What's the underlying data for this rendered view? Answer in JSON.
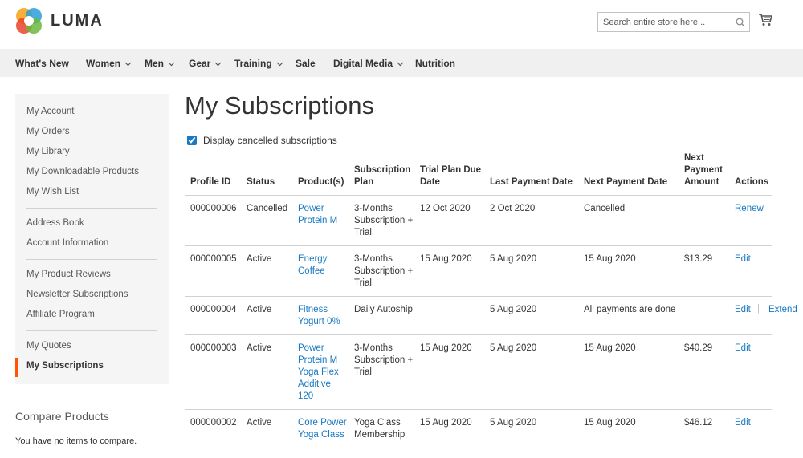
{
  "logo": {
    "text": "LUMA"
  },
  "search": {
    "placeholder": "Search entire store here..."
  },
  "nav": [
    {
      "label": "What's New",
      "dropdown": false
    },
    {
      "label": "Women",
      "dropdown": true
    },
    {
      "label": "Men",
      "dropdown": true
    },
    {
      "label": "Gear",
      "dropdown": true
    },
    {
      "label": "Training",
      "dropdown": true
    },
    {
      "label": "Sale",
      "dropdown": false
    },
    {
      "label": "Digital Media",
      "dropdown": true
    },
    {
      "label": "Nutrition",
      "dropdown": false
    }
  ],
  "sidebar": {
    "items": [
      "My Account",
      "My Orders",
      "My Library",
      "My Downloadable Products",
      "My Wish List",
      "Address Book",
      "Account Information",
      "My Product Reviews",
      "Newsletter Subscriptions",
      "Affiliate Program",
      "My Quotes",
      "My Subscriptions"
    ],
    "current": "My Subscriptions"
  },
  "compare": {
    "title": "Compare Products",
    "text": "You have no items to compare."
  },
  "page": {
    "title": "My Subscriptions",
    "display_cancelled_label": "Display cancelled subscriptions",
    "display_cancelled_checked": true
  },
  "table": {
    "headers": {
      "profile_id": "Profile ID",
      "status": "Status",
      "products": "Product(s)",
      "plan": "Subscription Plan",
      "trial": "Trial Plan Due Date",
      "last_payment": "Last Payment Date",
      "next_payment": "Next Payment Date",
      "next_amount": "Next Payment Amount",
      "actions": "Actions"
    },
    "rows": [
      {
        "profile_id": "000000006",
        "status": "Cancelled",
        "products": "Power Protein M",
        "plan": "3-Months Subscription + Trial",
        "trial": "12 Oct 2020",
        "last_payment": "2 Oct 2020",
        "next_payment": "Cancelled",
        "next_amount": "",
        "actions": [
          "Renew"
        ]
      },
      {
        "profile_id": "000000005",
        "status": "Active",
        "products": "Energy Coffee",
        "plan": "3-Months Subscription + Trial",
        "trial": "15 Aug 2020",
        "last_payment": "5 Aug 2020",
        "next_payment": "15 Aug 2020",
        "next_amount": "$13.29",
        "actions": [
          "Edit"
        ]
      },
      {
        "profile_id": "000000004",
        "status": "Active",
        "products": "Fitness Yogurt 0%",
        "plan": "Daily Autoship",
        "trial": "",
        "last_payment": "5 Aug 2020",
        "next_payment": "All payments are done",
        "next_amount": "",
        "actions": [
          "Edit",
          "Extend"
        ]
      },
      {
        "profile_id": "000000003",
        "status": "Active",
        "products": "Power Protein M Yoga Flex Additive 120",
        "plan": "3-Months Subscription + Trial",
        "trial": "15 Aug 2020",
        "last_payment": "5 Aug 2020",
        "next_payment": "15 Aug 2020",
        "next_amount": "$40.29",
        "actions": [
          "Edit"
        ]
      },
      {
        "profile_id": "000000002",
        "status": "Active",
        "products": "Core Power Yoga Class",
        "plan": "Yoga Class Membership",
        "trial": "15 Aug 2020",
        "last_payment": "5 Aug 2020",
        "next_payment": "15 Aug 2020",
        "next_amount": "$46.12",
        "actions": [
          "Edit"
        ]
      }
    ]
  }
}
